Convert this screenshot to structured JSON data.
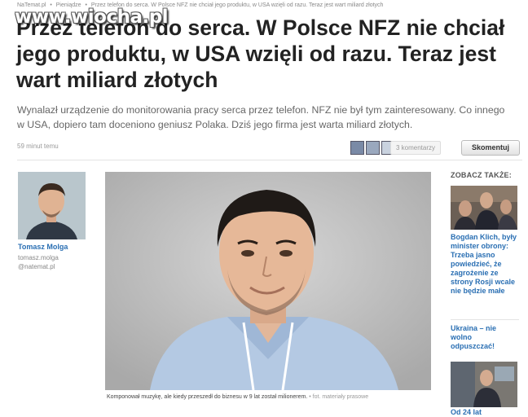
{
  "breadcrumb": {
    "items": [
      "NaTemat.pl",
      "Pieniądze",
      "Przez telefon do serca. W Polsce NFZ nie chciał jego produktu, w USA wzięli od razu. Teraz jest wart miliard złotych"
    ],
    "separator": "•"
  },
  "watermark": "www.wiocha.pl",
  "article": {
    "title": "Przez telefon do serca. W Polsce NFZ nie chciał jego produktu, w USA wzięli od razu. Teraz jest wart miliard złotych",
    "lead": "Wynalazł urządzenie do monitorowania pracy serca przez telefon. NFZ nie był tym zainteresowany. Co innego w USA, dopiero tam doceniono geniusz Polaka. Dziś jego firma jest warta miliard złotych.",
    "time_ago": "59 minut temu",
    "comments_count": "3 komentarzy",
    "comment_button": "Skomentuj"
  },
  "author": {
    "name": "Tomasz Molga",
    "handle_line1": "tomasz.molga",
    "handle_line2": "@natemat.pl"
  },
  "photo": {
    "caption": "Komponował muzykę, ale kiedy przeszedł do biznesu w 9 lat został milionerem.",
    "source": "• fot. materiały prasowe"
  },
  "sidebar": {
    "heading": "ZOBACZ TAKŻE:",
    "items": [
      {
        "text": "Bogdan Klich, były minister obrony: Trzeba jasno powiedzieć, że zagrożenie ze strony Rosji wcale nie będzie małe"
      },
      {
        "text": "Ukraina – nie wolno odpuszczać!"
      },
      {
        "text": "Od 24 lat"
      }
    ]
  },
  "colors": {
    "link": "#2a6fb3",
    "text": "#222222",
    "muted": "#888888"
  }
}
